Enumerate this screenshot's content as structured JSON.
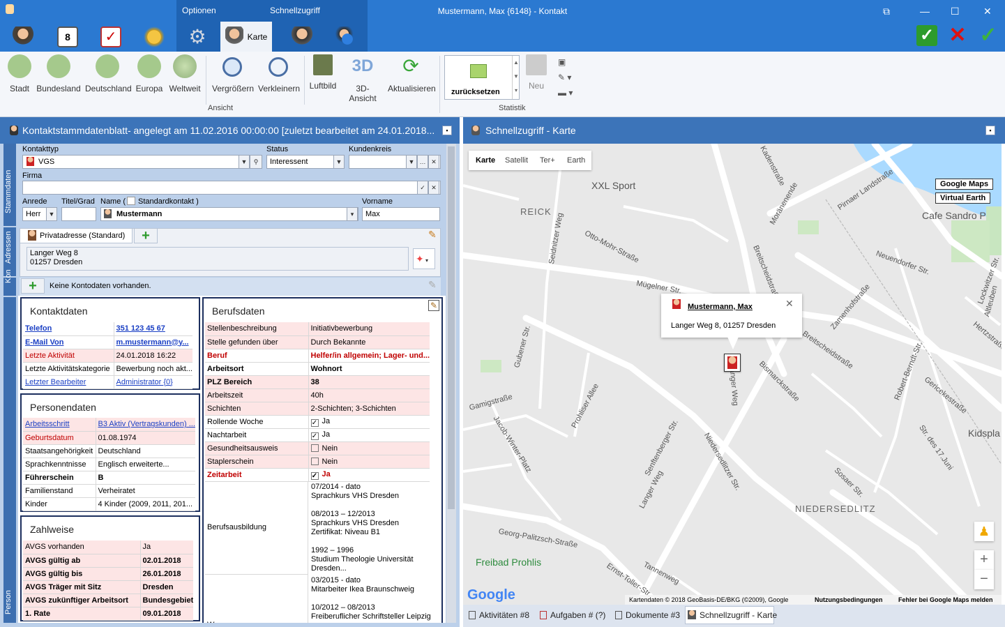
{
  "window": {
    "title": "Mustermann, Max {6148} - Kontakt"
  },
  "top_tabs": {
    "optionen": "Optionen",
    "schnellzugriff": "Schnellzugriff"
  },
  "active_module": "Karte",
  "ribbon": {
    "buttons": [
      "Stadt",
      "Bundesland",
      "Deutschland",
      "Europa",
      "Weltweit",
      "Vergrößern",
      "Verkleinern",
      "Luftbild",
      "3D-Ansicht",
      "Aktualisieren"
    ],
    "reset_label": "zurücksetzen",
    "neu_label": "Neu",
    "group_ansicht": "Ansicht",
    "group_statistik": "Statistik"
  },
  "left": {
    "header": "Kontaktstammdatenblatt- angelegt am 11.02.2016 00:00:00 [zuletzt bearbeitet am 24.01.2018...",
    "side_tabs": {
      "stammdaten": "Stammdaten",
      "adressen": "Adressen",
      "kon": "Kon",
      "person": "Person"
    },
    "kontakttyp_label": "Kontakttyp",
    "kontakttyp_value": "VGS",
    "status_label": "Status",
    "status_value": "Interessent",
    "kundenkreis_label": "Kundenkreis",
    "kundenkreis_value": "",
    "firma_label": "Firma",
    "firma_value": "",
    "anrede_label": "Anrede",
    "anrede_value": "Herr",
    "titel_label": "Titel/Grad",
    "titel_value": "",
    "name_label": "Name (",
    "standardkontakt_label": "Standardkontakt )",
    "name_value": "Mustermann",
    "vorname_label": "Vorname",
    "vorname_value": "Max",
    "address_tab": "Privatadresse (Standard)",
    "address_line1": "Langer Weg 8",
    "address_line2": "01257 Dresden",
    "konto_text": "Keine Kontodaten vorhanden.",
    "kontaktdaten": {
      "title": "Kontaktdaten",
      "rows": [
        [
          "Telefon",
          "351 123 45 67"
        ],
        [
          "E-Mail  Von",
          "m.mustermann@y..."
        ],
        [
          "Letzte Aktivität",
          "24.01.2018 16:22"
        ],
        [
          "Letzte Aktivitätskategorie",
          "Bewerbung noch akt..."
        ],
        [
          "Letzter Bearbeiter",
          "Administrator {0}"
        ]
      ]
    },
    "personendaten": {
      "title": "Personendaten",
      "rows": [
        [
          "Arbeitsschritt",
          "B3 Aktiv (Vertragskunden) ..."
        ],
        [
          "Geburtsdatum",
          "01.08.1974"
        ],
        [
          "Staatsangehörigkeit",
          "Deutschland"
        ],
        [
          "Sprachkenntnisse",
          "Englisch erweiterte..."
        ],
        [
          "Führerschein",
          "B"
        ],
        [
          "Familienstand",
          "Verheiratet"
        ],
        [
          "Kinder",
          "4 Kinder (2009, 2011, 201..."
        ]
      ]
    },
    "zahlweise": {
      "title": "Zahlweise",
      "rows": [
        [
          "AVGS vorhanden",
          "Ja"
        ],
        [
          "AVGS gültig ab",
          "02.01.2018"
        ],
        [
          "AVGS gültig bis",
          "26.01.2018"
        ],
        [
          "AVGS Träger mit Sitz",
          "Dresden"
        ],
        [
          "AVGS zukünftiger Arbeitsort",
          "Bundesgebiet"
        ],
        [
          "1. Rate",
          "09.01.2018"
        ]
      ]
    },
    "berufsdaten": {
      "title": "Berufsdaten",
      "rows": [
        [
          "Stellenbeschreibung",
          "Initiativbewerbung"
        ],
        [
          "Stelle gefunden über",
          "Durch Bekannte"
        ],
        [
          "Beruf",
          "Helfer/in allgemein; Lager- und..."
        ],
        [
          "Arbeitsort",
          "Wohnort"
        ],
        [
          "PLZ Bereich",
          "38"
        ],
        [
          "Arbeitszeit",
          "40h"
        ],
        [
          "Schichten",
          "2-Schichten; 3-Schichten"
        ],
        [
          "Rollende Woche",
          "Ja"
        ],
        [
          "Nachtarbeit",
          "Ja"
        ],
        [
          "Gesundheitsausweis",
          "Nein"
        ],
        [
          "Staplerschein",
          "Nein"
        ],
        [
          "Zeitarbeit",
          "Ja"
        ]
      ],
      "ausbildung_label": "Berufsausbildung",
      "ausbildung_lines": [
        "07/2014 - dato",
        "Sprachkurs  VHS  Dresden",
        "",
        "08/2013 – 12/2013",
        "Sprachkurs VHS  Dresden",
        "Zertifikat: Niveau B1",
        "",
        "1992 – 1996",
        "Studium Theologie Universität",
        "Dresden..."
      ],
      "more_lines": [
        "03/2015 - dato",
        "Mitarbeiter Ikea  Braunschweig",
        "",
        "10/2012 – 08/2013",
        "Freiberuflicher Schriftsteller  Leipzig"
      ],
      "truncated_label": "W..."
    }
  },
  "right": {
    "header": "Schnellzugriff - Karte",
    "map_types": [
      "Karte",
      "Satellit",
      "Ter+",
      "Earth"
    ],
    "google_maps_btn": "Google Maps",
    "virtual_earth_btn": "Virtual Earth",
    "popup_name": "Mustermann, Max",
    "popup_address": "Langer Weg 8, 01257 Dresden",
    "places": [
      "XXL Sport",
      "Cafe Sandro P",
      "Freibad Prohlis",
      "Kidspla",
      "REICK",
      "NIEDERSEDLITZ"
    ],
    "streets": [
      "Kadenstraße",
      "Moränenende",
      "Pirnaer Landstraße",
      "Otto-Mohr-Straße",
      "Seidnitzer Weg",
      "Mügelner Str.",
      "Breitscheidstraße",
      "Neuendorfer Str.",
      "Zamenhofstraße",
      "Breitscheidstraße",
      "Lockwitzer Str.",
      "Gubener Str.",
      "Bismarckstraße",
      "Robert-Berndt-Str.",
      "Gamigstraße",
      "Jacob-Winter-Platz",
      "Prohliser Allee",
      "Senftenberger Str.",
      "Langer Weg",
      "Niedersedlitzer Str.",
      "Str. des 17.Juni",
      "Georg-Palitzsch-Straße",
      "Sosaer Str.",
      "Gericekestraße",
      "Hertzstraße",
      "Altleuben",
      "Tannenweg",
      "Ernst-Toller-Str.",
      "Langer Weg"
    ],
    "attribution": "Kartendaten © 2018 GeoBasis-DE/BKG (©2009), Google",
    "terms": "Nutzungsbedingungen",
    "report": "Fehler bei Google Maps melden",
    "google_logo": "Google",
    "bottom_tabs": [
      "Aktivitäten #8",
      "Aufgaben # (?)",
      "Dokumente #3",
      "Schnellzugriff - Karte"
    ]
  },
  "colors": {
    "accent": "#2b79d1",
    "header": "#3c74b9",
    "card_border": "#1c2f5e",
    "highlight": "#fde5e5"
  }
}
